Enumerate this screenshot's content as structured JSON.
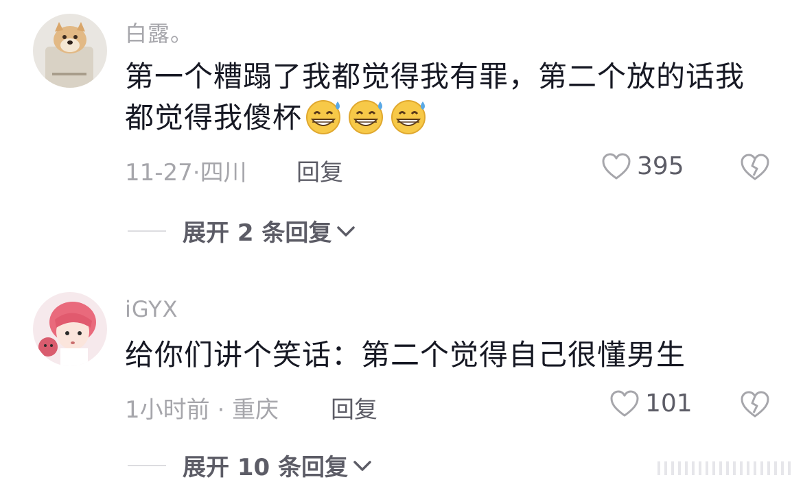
{
  "comments": [
    {
      "username": "白露。",
      "text": "第一个糟蹋了我都觉得我有罪，第二个放的话我都觉得我傻杯",
      "emoji_count": 3,
      "emoji_icon": "grinning-sweat-emoji",
      "date": "11-27",
      "location": "四川",
      "meta_separator": "·",
      "reply_label": "回复",
      "likes": "395",
      "expand_label": "展开 2 条回复"
    },
    {
      "username": "iGYX",
      "text": "给你们讲个笑话：第二个觉得自己很懂男生",
      "date": "1小时前",
      "location": "重庆",
      "meta_separator": " · ",
      "reply_label": "回复",
      "likes": "101",
      "expand_label": "展开 10 条回复"
    }
  ],
  "icons": {
    "like": "heart-outline-icon",
    "dislike": "broken-heart-icon",
    "expand": "chevron-down-icon"
  },
  "colors": {
    "text": "#161823",
    "muted": "#a6a6ab",
    "secondary": "#5c5c66",
    "emoji_face": "#f7c948",
    "emoji_sweat": "#5aa9e6"
  }
}
